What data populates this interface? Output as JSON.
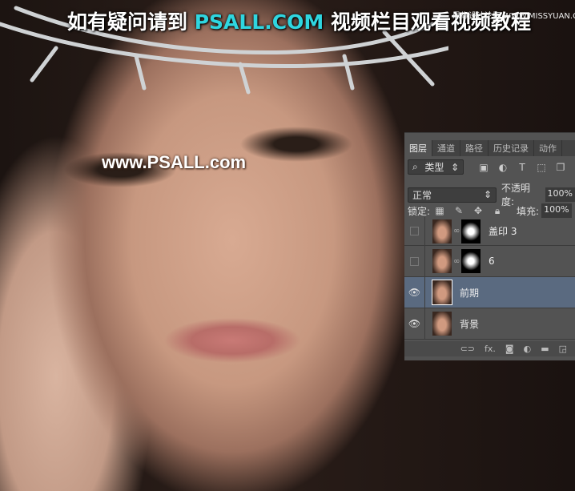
{
  "watermark": {
    "pre": "如有疑问请到 ",
    "highlight": "PSALL.COM",
    "post": " 视频栏目观看视频教程"
  },
  "site": "思缘设计论坛 WWW.MISSYUAN.COM",
  "photo_watermark": "www.PSALL.com",
  "panel": {
    "tabs": [
      "图层",
      "通道",
      "路径",
      "历史记录",
      "动作"
    ],
    "filter": {
      "label": "类型",
      "icon": "search-icon"
    },
    "filter_icons": [
      "image-icon",
      "adjustment-icon",
      "type-icon",
      "shape-icon",
      "smart-object-icon"
    ],
    "blend_mode": "正常",
    "opacity_label": "不透明度:",
    "opacity_value": "100%",
    "lock_label": "锁定:",
    "fill_label": "填充:",
    "fill_value": "100%",
    "layers": [
      {
        "name": "盖印 3",
        "visible": false,
        "mask": true
      },
      {
        "name": "6",
        "visible": false,
        "mask": true
      },
      {
        "name": "前期",
        "visible": true,
        "selected": true
      },
      {
        "name": "背景",
        "visible": true
      }
    ],
    "bottom_icons": [
      "link-icon",
      "fx-icon",
      "mask-icon",
      "adjustment-icon",
      "group-icon",
      "new-layer-icon"
    ],
    "bottom_fx": "fx."
  }
}
